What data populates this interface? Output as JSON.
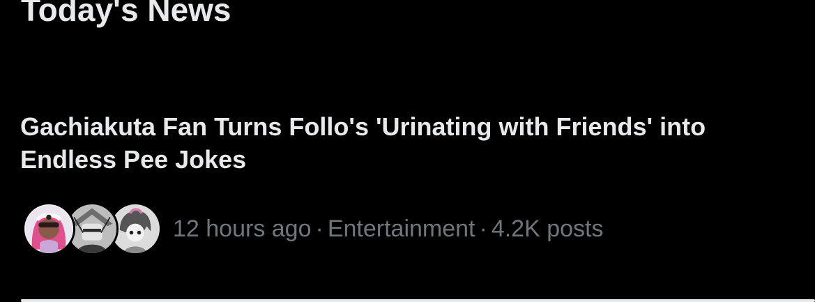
{
  "section": {
    "title": "Today's News"
  },
  "story": {
    "headline": "Gachiakuta Fan Turns Follo's 'Urinating with Friends' into Endless Pee Jokes",
    "time_ago": "12 hours ago",
    "separator": "·",
    "category": "Entertainment",
    "posts": "4.2K posts",
    "avatars": [
      "pink-hair-avatar",
      "manga-character-avatar",
      "manga-girl-avatar"
    ]
  },
  "colors": {
    "background": "#000000",
    "primary_text": "#e7e9ea",
    "secondary_text": "#71767b"
  }
}
